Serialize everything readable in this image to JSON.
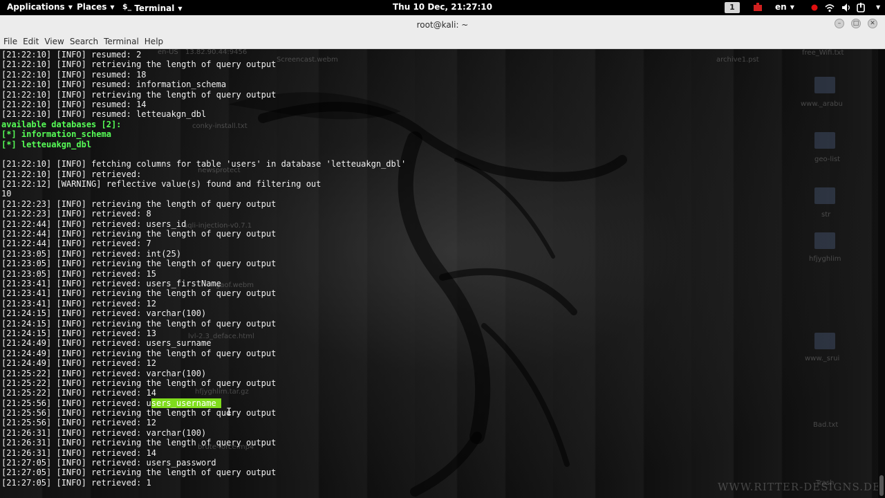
{
  "top_panel": {
    "applications": "Applications",
    "places": "Places",
    "terminal": "Terminal",
    "clock": "Thu 10 Dec, 21:27:10",
    "workspace": "1",
    "language": "en"
  },
  "window": {
    "title": "root@kali: ~"
  },
  "menubar": [
    "File",
    "Edit",
    "View",
    "Search",
    "Terminal",
    "Help"
  ],
  "desktop_ghosts": {
    "en_us": "en-US",
    "ip": "13.82.90.44:9456",
    "screencast": "Screencast.webm",
    "archive": "archive1.pst",
    "free_wifi": "free_Wifi.txt",
    "conky": "conky-install.txt",
    "www_arab": "www._arabu",
    "geo_list": "geo-list",
    "news": "newsprotect",
    "str": "str",
    "sqli": "sqli-injection-v0.7.1",
    "hfjyg": "hfjyghlim",
    "webm": "gaof.webm",
    "deface": "lvl-2.3_deface.html",
    "www_srui": "www._srui",
    "tar": "hfjyghlim.tar.gz",
    "bad": "Bad.txt",
    "mp4": "brute-force.mp4",
    "trash": "Trash",
    "watermark": "WWW.RITTER-DESIGNS.DE"
  },
  "terminal": {
    "lines": [
      {
        "text": "[21:22:10] [INFO] resumed: 2"
      },
      {
        "text": "[21:22:10] [INFO] retrieving the length of query output"
      },
      {
        "text": "[21:22:10] [INFO] resumed: 18"
      },
      {
        "text": "[21:22:10] [INFO] resumed: information_schema"
      },
      {
        "text": "[21:22:10] [INFO] retrieving the length of query output"
      },
      {
        "text": "[21:22:10] [INFO] resumed: 14"
      },
      {
        "text": "[21:22:10] [INFO] resumed: letteuakgn_dbl"
      },
      {
        "text": "available databases [2]:",
        "style": "green"
      },
      {
        "text": "[*] information_schema",
        "style": "green"
      },
      {
        "text": "[*] letteuakgn_dbl",
        "style": "green"
      },
      {
        "text": ""
      },
      {
        "text": "[21:22:10] [INFO] fetching columns for table 'users' in database 'letteuakgn_dbl'"
      },
      {
        "text": "[21:22:10] [INFO] retrieved: "
      },
      {
        "text": "[21:22:12] [WARNING] reflective value(s) found and filtering out"
      },
      {
        "text": "10"
      },
      {
        "text": "[21:22:23] [INFO] retrieving the length of query output"
      },
      {
        "text": "[21:22:23] [INFO] retrieved: 8"
      },
      {
        "text": "[21:22:44] [INFO] retrieved: users_id"
      },
      {
        "text": "[21:22:44] [INFO] retrieving the length of query output"
      },
      {
        "text": "[21:22:44] [INFO] retrieved: 7"
      },
      {
        "text": "[21:23:05] [INFO] retrieved: int(25)"
      },
      {
        "text": "[21:23:05] [INFO] retrieving the length of query output"
      },
      {
        "text": "[21:23:05] [INFO] retrieved: 15"
      },
      {
        "text": "[21:23:41] [INFO] retrieved: users_firstName"
      },
      {
        "text": "[21:23:41] [INFO] retrieving the length of query output"
      },
      {
        "text": "[21:23:41] [INFO] retrieved: 12"
      },
      {
        "text": "[21:24:15] [INFO] retrieved: varchar(100)"
      },
      {
        "text": "[21:24:15] [INFO] retrieving the length of query output"
      },
      {
        "text": "[21:24:15] [INFO] retrieved: 13"
      },
      {
        "text": "[21:24:49] [INFO] retrieved: users_surname"
      },
      {
        "text": "[21:24:49] [INFO] retrieving the length of query output"
      },
      {
        "text": "[21:24:49] [INFO] retrieved: 12"
      },
      {
        "text": "[21:25:22] [INFO] retrieved: varchar(100)"
      },
      {
        "text": "[21:25:22] [INFO] retrieving the length of query output"
      },
      {
        "text": "[21:25:22] [INFO] retrieved: 14"
      },
      {
        "text": "[21:25:56] [INFO] retrieved: u",
        "selected": "sers_username "
      },
      {
        "text": "[21:25:56] [INFO] retrieving the length of query output"
      },
      {
        "text": "[21:25:56] [INFO] retrieved: 12"
      },
      {
        "text": "[21:26:31] [INFO] retrieved: varchar(100)"
      },
      {
        "text": "[21:26:31] [INFO] retrieving the length of query output"
      },
      {
        "text": "[21:26:31] [INFO] retrieved: 14"
      },
      {
        "text": "[21:27:05] [INFO] retrieved: users_password"
      },
      {
        "text": "[21:27:05] [INFO] retrieving the length of query output"
      },
      {
        "text": "[21:27:05] [INFO] retrieved: 1"
      }
    ]
  },
  "colors": {
    "panel_bg": "#000000",
    "titlebar_bg": "#ececec",
    "term_fg": "#f2f2f2",
    "term_green": "#57ff57",
    "selection": "#7fdc1c"
  },
  "icons": [
    "terminal-icon",
    "workspace-indicator",
    "recording-icon",
    "network-icon",
    "volume-icon",
    "power-icon"
  ]
}
